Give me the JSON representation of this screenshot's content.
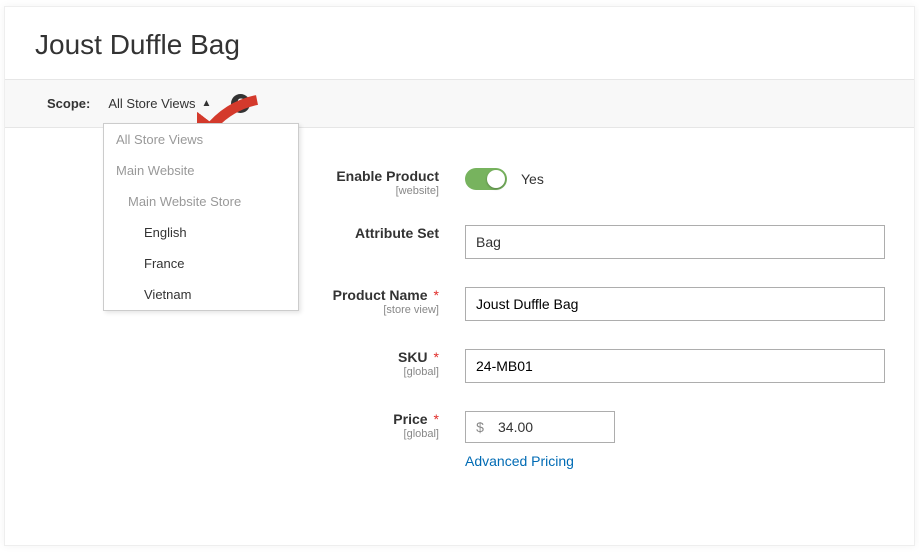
{
  "page_title": "Joust Duffle Bag",
  "scope": {
    "label": "Scope:",
    "selected": "All Store Views",
    "help": "?",
    "options": [
      {
        "label": "All Store Views",
        "level": 0,
        "disabled": true
      },
      {
        "label": "Main Website",
        "level": 0,
        "disabled": true
      },
      {
        "label": "Main Website Store",
        "level": 1,
        "disabled": true
      },
      {
        "label": "English",
        "level": 2,
        "disabled": false
      },
      {
        "label": "France",
        "level": 2,
        "disabled": false
      },
      {
        "label": "Vietnam",
        "level": 2,
        "disabled": false
      }
    ]
  },
  "form": {
    "enable_product": {
      "label": "Enable Product",
      "sublabel": "[website]",
      "value_label": "Yes"
    },
    "attribute_set": {
      "label": "Attribute Set",
      "value": "Bag"
    },
    "product_name": {
      "label": "Product Name",
      "sublabel": "[store view]",
      "value": "Joust Duffle Bag"
    },
    "sku": {
      "label": "SKU",
      "sublabel": "[global]",
      "value": "24-MB01"
    },
    "price": {
      "label": "Price",
      "sublabel": "[global]",
      "currency": "$",
      "value": "34.00",
      "advanced_link": "Advanced Pricing"
    }
  }
}
